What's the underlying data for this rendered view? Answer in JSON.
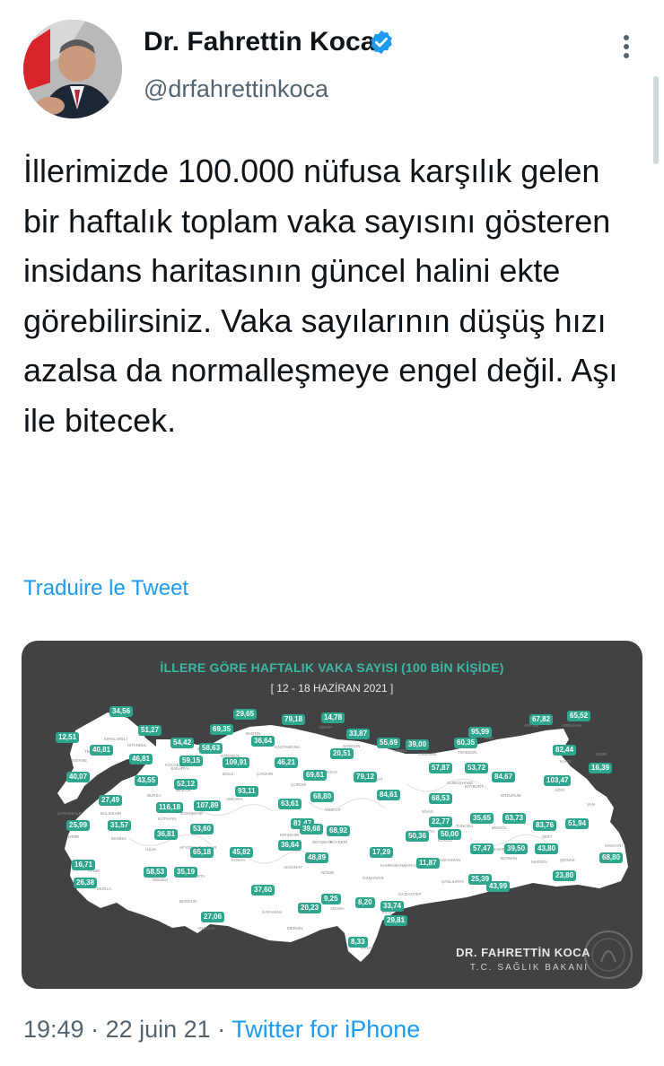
{
  "author": {
    "name": "Dr. Fahrettin Koca",
    "handle": "@drfahrettinkoca",
    "verified_icon": "verified-badge-icon"
  },
  "tweet": {
    "text": "İllerimizde 100.000 nüfusa karşılık gelen bir haftalık toplam vaka sayısını gösteren insidans haritasının güncel halini ekte görebilirsiniz. Vaka sayılarının düşüş hızı azalsa da normalleşmeye engel değil. Aşı ile bitecek.",
    "translate_label": "Traduire le Tweet"
  },
  "media": {
    "title": "İLLERE GÖRE HAFTALIK VAKA SAYISI (100 BİN KİŞİDE)",
    "date_range": "[ 12 - 18 HAZİRAN 2021 ]",
    "signature_name": "DR. FAHRETTİN KOCA",
    "signature_title": "T.C. SAĞLIK BAKANI",
    "colors": {
      "map_bg": "#404244",
      "land": "#ffffff",
      "badge": "#2ea58d",
      "title": "#3cb89f"
    },
    "values": [
      "34,56",
      "29,65",
      "79,18",
      "14,78",
      "51,27",
      "69,35",
      "12,51",
      "54,42",
      "36,64",
      "33,87",
      "67,82",
      "65,52",
      "95,99",
      "40,81",
      "58,63",
      "20,51",
      "60,35",
      "39,00",
      "55,69",
      "82,44",
      "46,81",
      "59,15",
      "109,91",
      "46,21",
      "69,61",
      "79,12",
      "57,87",
      "53,72",
      "84,67",
      "16,39",
      "40,07",
      "43,55",
      "52,12",
      "93,11",
      "68,80",
      "84,61",
      "103,47",
      "27,49",
      "116,18",
      "107,89",
      "63,61",
      "81,47",
      "68,53",
      "35,65",
      "63,73",
      "25,99",
      "31,57",
      "53,60",
      "39,68",
      "68,92",
      "22,77",
      "83,76",
      "51,94",
      "36,81",
      "65,18",
      "45,82",
      "36,64",
      "48,89",
      "17,29",
      "50,36",
      "50,00",
      "57,47",
      "39,50",
      "43,80",
      "68,80",
      "16,71",
      "58,53",
      "35,19",
      "11,87",
      "25,39",
      "23,80",
      "26,38",
      "37,60",
      "9,25",
      "8,20",
      "33,74",
      "43,99",
      "27,06",
      "20,23",
      "29,81",
      "8,33"
    ],
    "place_labels": [
      "KIRKLARELİ",
      "EDİRNE",
      "TEKİRDAĞ",
      "İSTANBUL",
      "KOCAELİ",
      "BARTIN",
      "KASTAMONU",
      "SİNOP",
      "SAMSUN",
      "ORDU",
      "GİRESUN",
      "TRABZON",
      "RİZE",
      "ARTVİN",
      "ARDAHAN",
      "KARS",
      "IĞDIR",
      "AĞRI",
      "VAN",
      "HAKKARİ",
      "ŞIRNAK",
      "SİİRT",
      "BATMAN",
      "MARDİN",
      "ŞANLIURFA",
      "GAZİANTEP",
      "KİLİS",
      "HATAY",
      "ADANA",
      "MERSİN",
      "ANTALYA",
      "MUĞLA",
      "AYDIN",
      "İZMİR",
      "MANİSA",
      "BALIKESİR",
      "ÇANAKKALE",
      "BURSA",
      "ESKİŞEHİR",
      "ANKARA",
      "KONYA",
      "KAYSERİ",
      "SİVAS",
      "MALATYA",
      "ELAZIĞ",
      "ERZURUM",
      "ERZİNCAN",
      "BİNGÖL",
      "MUŞ",
      "BİTLİS",
      "DİYARBAKIR",
      "ADIYAMAN",
      "KAHRAMANMARAŞ",
      "OSMANİYE",
      "KARAMAN",
      "NİĞDE",
      "AKSARAY",
      "NEVŞEHİR",
      "KIRŞEHİR",
      "YOZGAT",
      "ÇORUM",
      "AMASYA",
      "TOKAT",
      "ÇANKIRI",
      "KARABÜK",
      "ZONGULDAK",
      "DÜZCE",
      "SAKARYA",
      "BOLU",
      "BİLECİK",
      "KÜTAHYA",
      "UŞAK",
      "DENİZLİ",
      "AFYONKARAHİSAR",
      "ISPARTA",
      "BURDUR",
      "GÜMÜŞHANE",
      "BAYBURT",
      "TUNCELİ"
    ]
  },
  "footer": {
    "time": "19:49",
    "sep1": " · ",
    "date": "22 juin 21",
    "sep2": " · ",
    "source": "Twitter for iPhone"
  }
}
